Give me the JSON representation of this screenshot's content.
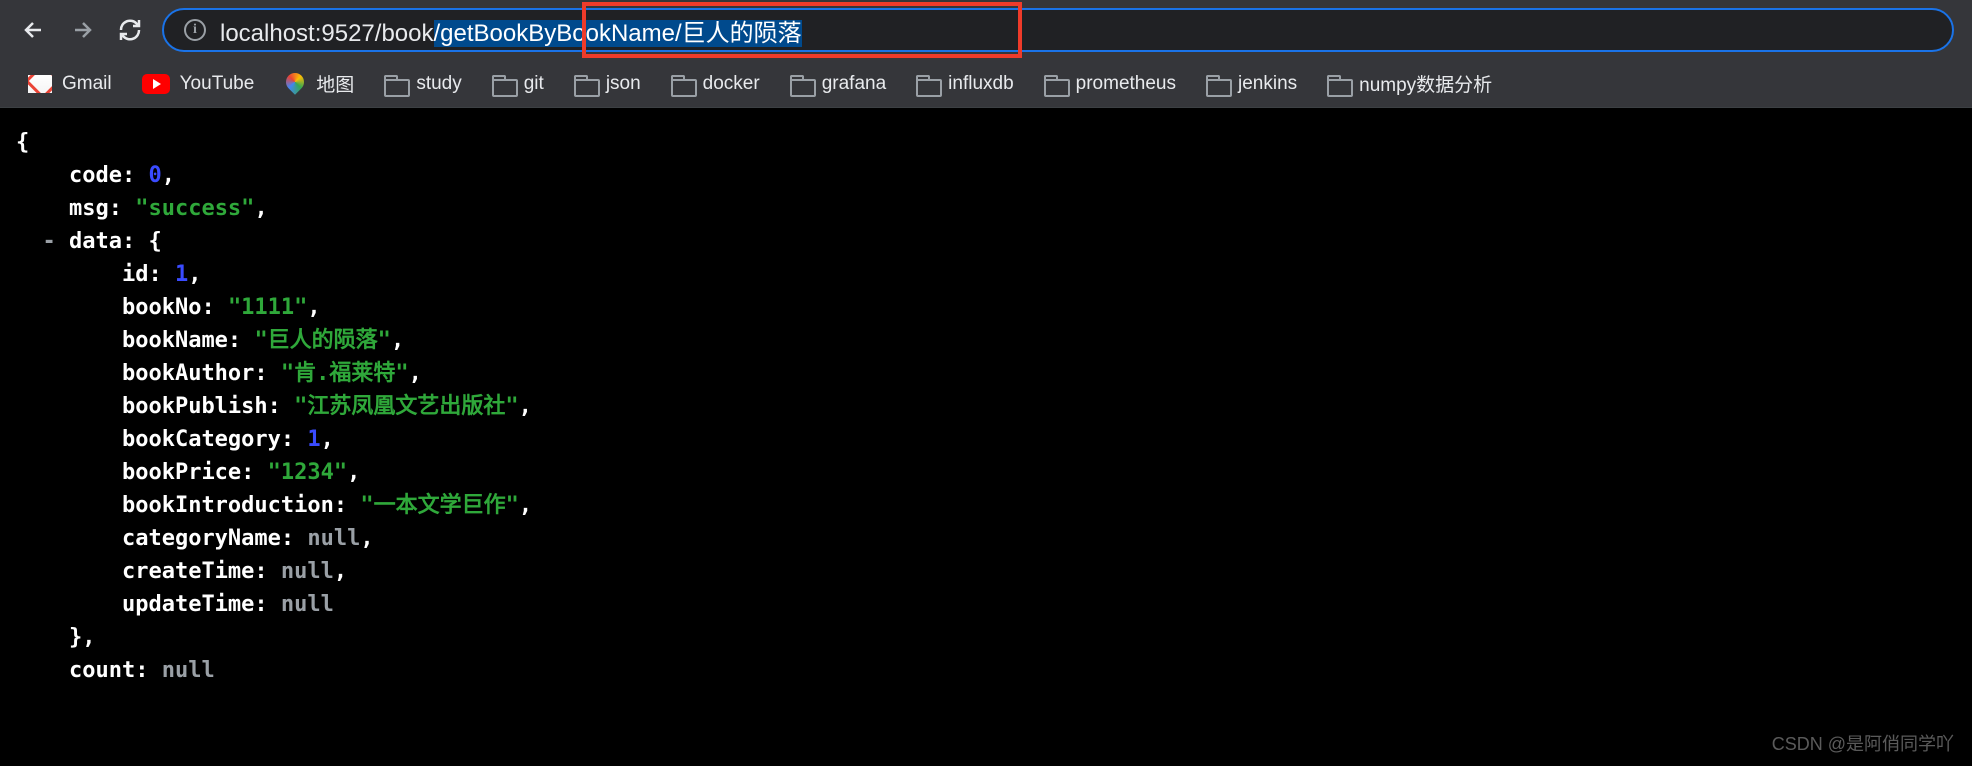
{
  "url_prefix": "localhost:9527/book",
  "url_selected": "/getBookByBookName/巨人的陨落",
  "bookmarks": [
    {
      "label": "Gmail",
      "icon": "gmail"
    },
    {
      "label": "YouTube",
      "icon": "youtube"
    },
    {
      "label": "地图",
      "icon": "maps"
    },
    {
      "label": "study",
      "icon": "folder"
    },
    {
      "label": "git",
      "icon": "folder"
    },
    {
      "label": "json",
      "icon": "folder"
    },
    {
      "label": "docker",
      "icon": "folder"
    },
    {
      "label": "grafana",
      "icon": "folder"
    },
    {
      "label": "influxdb",
      "icon": "folder"
    },
    {
      "label": "prometheus",
      "icon": "folder"
    },
    {
      "label": "jenkins",
      "icon": "folder"
    },
    {
      "label": "numpy数据分析",
      "icon": "folder"
    }
  ],
  "json": {
    "code_k": "code:",
    "code_v": "0",
    "msg_k": "msg:",
    "msg_v": "\"success\"",
    "data_k": "data:",
    "id_k": "id:",
    "id_v": "1",
    "bookNo_k": "bookNo:",
    "bookNo_v": "\"1111\"",
    "bookName_k": "bookName:",
    "bookName_v": "\"巨人的陨落\"",
    "bookAuthor_k": "bookAuthor:",
    "bookAuthor_v": "\"肯.福莱特\"",
    "bookPublish_k": "bookPublish:",
    "bookPublish_v": "\"江苏凤凰文艺出版社\"",
    "bookCategory_k": "bookCategory:",
    "bookCategory_v": "1",
    "bookPrice_k": "bookPrice:",
    "bookPrice_v": "\"1234\"",
    "bookIntroduction_k": "bookIntroduction:",
    "bookIntroduction_v": "\"一本文学巨作\"",
    "categoryName_k": "categoryName:",
    "categoryName_v": "null",
    "createTime_k": "createTime:",
    "createTime_v": "null",
    "updateTime_k": "updateTime:",
    "updateTime_v": "null",
    "count_k": "count:",
    "count_v": "null"
  },
  "brace_open": "{",
  "brace_close": "},",
  "collapse": "-",
  "comma": ",",
  "watermark": "CSDN @是阿俏同学吖"
}
